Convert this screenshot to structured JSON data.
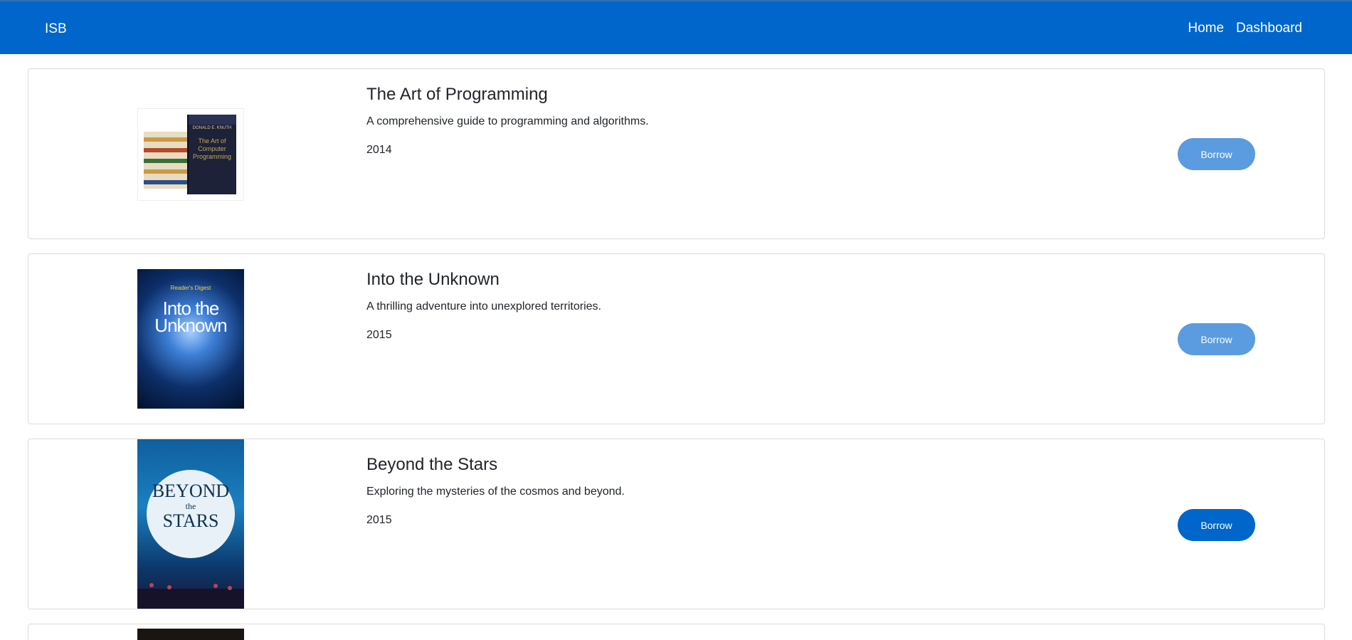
{
  "nav": {
    "brand": "ISB",
    "links": [
      "Home",
      "Dashboard"
    ]
  },
  "books": [
    {
      "title": "The Art of Programming",
      "description": "A comprehensive guide to programming and algorithms.",
      "year": "2014",
      "action": "Borrow",
      "cover_title": "The Art of Computer Programming",
      "cover_author": "DONALD E. KNUTH"
    },
    {
      "title": "Into the Unknown",
      "description": "A thrilling adventure into unexplored territories.",
      "year": "2015",
      "action": "Borrow",
      "cover_publisher": "Reader's Digest",
      "cover_title_1": "Into the",
      "cover_title_2": "Unknown"
    },
    {
      "title": "Beyond the Stars",
      "description": "Exploring the mysteries of the cosmos and beyond.",
      "year": "2015",
      "action": "Borrow",
      "cover_title_1": "BEYOND",
      "cover_title_2": "the",
      "cover_title_3": "STARS"
    }
  ],
  "colors": {
    "nav_bg": "#0066cc",
    "button_active": "#0066cc",
    "button_faded": "#5b9be0",
    "card_border": "#dcdcdc"
  }
}
